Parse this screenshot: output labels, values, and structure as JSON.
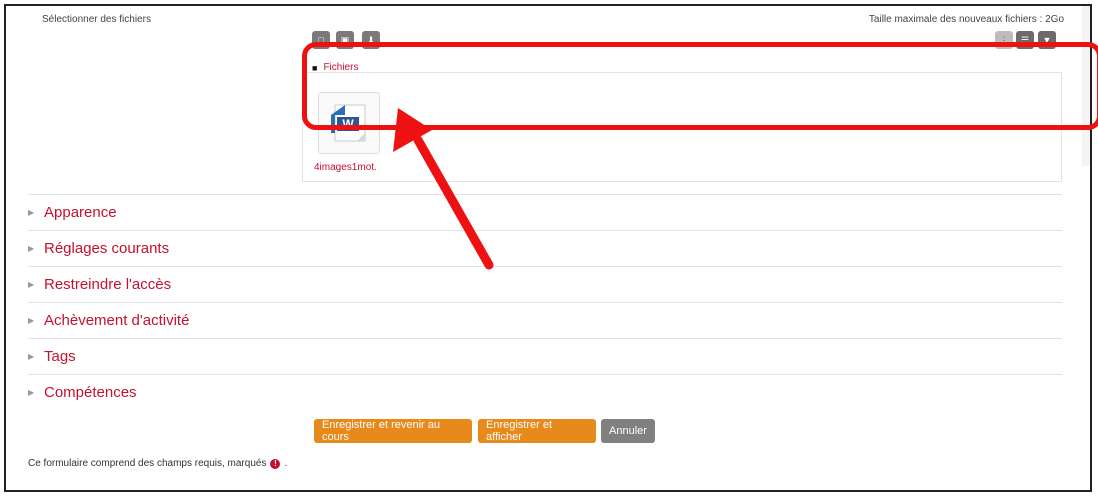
{
  "file_picker": {
    "label": "Sélectionner des fichiers",
    "max_size": "Taille maximale des nouveaux fichiers : 2Go",
    "path_root": "Fichiers",
    "file_name": "4images1mot.",
    "icons": [
      "add-file-icon",
      "create-folder-icon",
      "download-icon",
      "grid-view-icon",
      "list-view-icon",
      "tree-view-icon",
      "folder-icon",
      "word-document-icon"
    ]
  },
  "sections": [
    {
      "label": "Apparence"
    },
    {
      "label": "Réglages courants"
    },
    {
      "label": "Restreindre l'accès"
    },
    {
      "label": "Achèvement d'activité"
    },
    {
      "label": "Tags"
    },
    {
      "label": "Compétences"
    }
  ],
  "buttons": {
    "save_return": "Enregistrer et revenir au cours",
    "save_display": "Enregistrer et afficher",
    "cancel": "Annuler"
  },
  "footer": {
    "required_note": "Ce formulaire comprend des champs requis, marqués",
    "required_icon": "!",
    "trailing": "."
  },
  "colors": {
    "accent": "#c8102e",
    "primary_button": "#e8891b",
    "secondary_button": "#808080",
    "annotation": "#ee1111"
  }
}
